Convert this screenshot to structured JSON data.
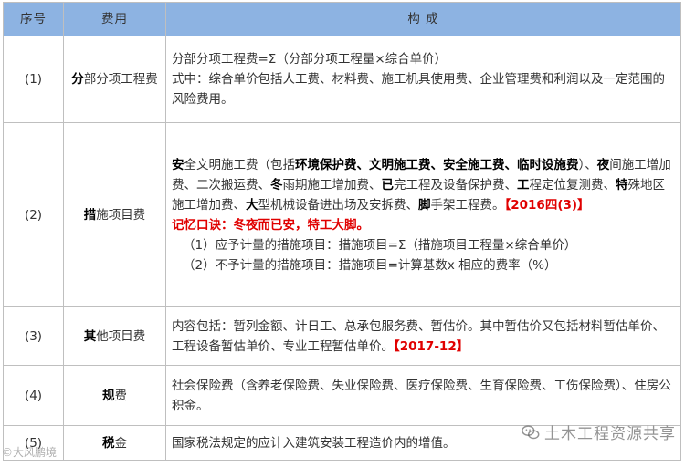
{
  "header": {
    "idx": "序号",
    "fee": "费用",
    "comp": "构 成"
  },
  "rows": [
    {
      "idx": "(1)",
      "fee_lead": "分",
      "fee_rest": "部分项工程费",
      "lines": [
        "分部分项工程费=Σ（分部分项工程量×综合单价）",
        "式中：综合单价包括人工费、材料费、施工机具使用费、企业管理费和利润以及一定范围的风险费用。"
      ]
    },
    {
      "idx": "(2)",
      "fee_lead": "措",
      "fee_rest": "施项目费",
      "p1": [
        {
          "t": "安",
          "b": true
        },
        {
          "t": "全文明施工费（包括"
        },
        {
          "t": "环境保护费、文明施工费、安全施工费、临时设施费",
          "b": true
        },
        {
          "t": "）、"
        },
        {
          "t": "夜",
          "b": true
        },
        {
          "t": "间施工增加费、二次搬运费、"
        },
        {
          "t": "冬",
          "b": true
        },
        {
          "t": "雨期施工增加费、"
        },
        {
          "t": "已",
          "b": true
        },
        {
          "t": "完工程及设备保护费、"
        },
        {
          "t": "工",
          "b": true
        },
        {
          "t": "程定位复测费、"
        },
        {
          "t": "特",
          "b": true
        },
        {
          "t": "殊地区施工增加费、"
        },
        {
          "t": "大",
          "b": true
        },
        {
          "t": "型机械设备进出场及安拆费、"
        },
        {
          "t": "脚",
          "b": true
        },
        {
          "t": "手架工程费。"
        },
        {
          "t": "【2016四(3)】",
          "red": true
        }
      ],
      "mnemonic": "记忆口诀：冬夜而已安，特工大脚。",
      "sub1": "（1）应予计量的措施项目：措施项目=Σ（措施项目工程量×综合单价）",
      "sub2": "（2）不予计量的措施项目：措施项目=计算基数x 相应的费率（%）"
    },
    {
      "idx": "(3)",
      "fee_lead": "其",
      "fee_rest": "他项目费",
      "text": "内容包括：暂列金额、计日工、总承包服务费、暂估价。其中暂估价又包括材料暂估单价、工程设备暂估单价、专业工程暂估单价。",
      "tag": "【2017-12】"
    },
    {
      "idx": "(4)",
      "fee_lead": "规",
      "fee_rest": "费",
      "text": "社会保险费（含养老保险费、失业保险费、医疗保险费、生育保险费、工伤保险费）、住房公积金。"
    },
    {
      "idx": "(5)",
      "fee_lead": "税",
      "fee_rest": "金",
      "text": "国家税法规定的应计入建筑安装工程造价内的增值。"
    }
  ],
  "watermark": {
    "right": "土木工程资源共享",
    "left": "©大风鹏境"
  }
}
